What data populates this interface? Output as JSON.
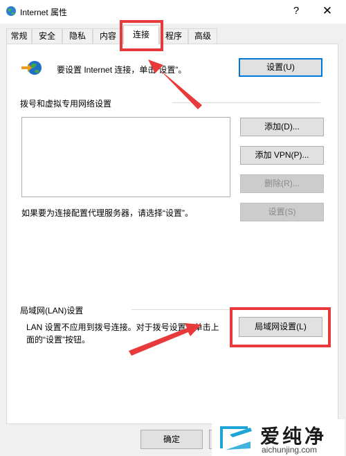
{
  "window": {
    "title": "Internet 属性",
    "help": "?",
    "close": "✕"
  },
  "tabs": [
    {
      "label": "常规"
    },
    {
      "label": "安全"
    },
    {
      "label": "隐私"
    },
    {
      "label": "内容"
    },
    {
      "label": "连接",
      "active": true
    },
    {
      "label": "程序"
    },
    {
      "label": "高级"
    }
  ],
  "connection": {
    "setup_text": "要设置 Internet 连接，单击“设置”。",
    "setup_button": "设置(U)"
  },
  "dialup": {
    "group_label": "拨号和虚拟专用网络设置",
    "add_button": "添加(D)...",
    "add_vpn_button": "添加 VPN(P)...",
    "remove_button": "删除(R)...",
    "settings_button": "设置(S)",
    "proxy_text": "如果要为连接配置代理服务器，请选择“设置”。"
  },
  "lan": {
    "group_label": "局域网(LAN)设置",
    "desc_line1": "LAN 设置不应用到拨号连接。对于拨号设置，单击上",
    "desc_line2": "面的“设置”按钮。",
    "lan_button": "局域网设置(L)"
  },
  "footer": {
    "ok_button": "确定"
  },
  "watermark": {
    "name": "爱纯净",
    "url": "aichunjing.com"
  },
  "colors": {
    "highlight": "#e83a3a",
    "default_button_border": "#0078d7"
  }
}
